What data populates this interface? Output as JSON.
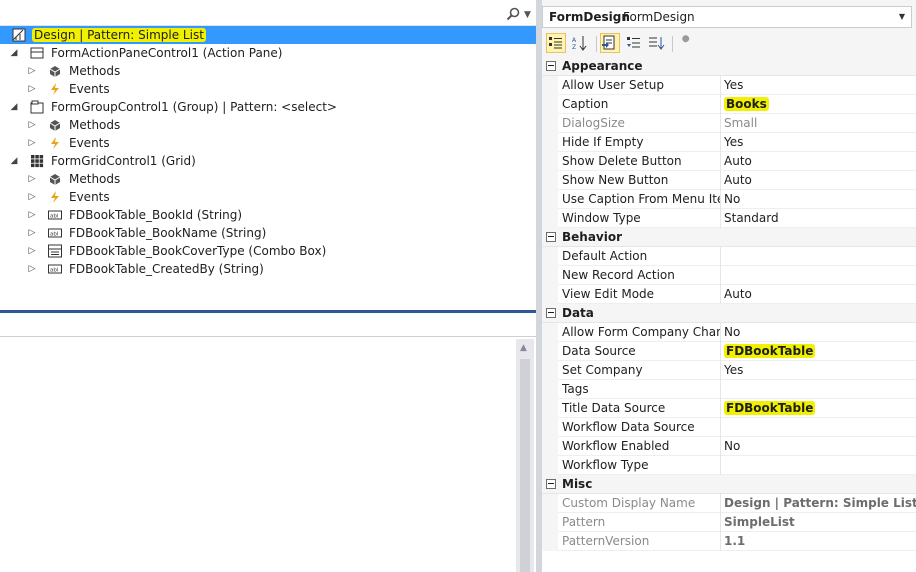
{
  "tree": {
    "root": {
      "label": "Design | Pattern: Simple List"
    },
    "nodes": [
      {
        "label": "FormActionPaneControl1 (Action Pane)"
      },
      {
        "label": "Methods"
      },
      {
        "label": "Events"
      },
      {
        "label": "FormGroupControl1 (Group) | Pattern: <select>"
      },
      {
        "label": "Methods"
      },
      {
        "label": "Events"
      },
      {
        "label": "FormGridControl1 (Grid)"
      },
      {
        "label": "Methods"
      },
      {
        "label": "Events"
      },
      {
        "label": "FDBookTable_BookId (String)"
      },
      {
        "label": "FDBookTable_BookName (String)"
      },
      {
        "label": "FDBookTable_BookCoverType (Combo Box)"
      },
      {
        "label": "FDBookTable_CreatedBy (String)"
      }
    ]
  },
  "properties": {
    "object_name": "FormDesign",
    "object_type": "FormDesign",
    "categories": [
      {
        "title": "Appearance",
        "rows": [
          {
            "name": "Allow User Setup",
            "value": "Yes"
          },
          {
            "name": "Caption",
            "value": "Books"
          },
          {
            "name": "DialogSize",
            "value": "Small"
          },
          {
            "name": "Hide If Empty",
            "value": "Yes"
          },
          {
            "name": "Show Delete Button",
            "value": "Auto"
          },
          {
            "name": "Show New Button",
            "value": "Auto"
          },
          {
            "name": "Use Caption From Menu Item",
            "value": "No"
          },
          {
            "name": "Window Type",
            "value": "Standard"
          }
        ]
      },
      {
        "title": "Behavior",
        "rows": [
          {
            "name": "Default Action",
            "value": ""
          },
          {
            "name": "New Record Action",
            "value": ""
          },
          {
            "name": "View Edit Mode",
            "value": "Auto"
          }
        ]
      },
      {
        "title": "Data",
        "rows": [
          {
            "name": "Allow Form Company Change",
            "value": "No"
          },
          {
            "name": "Data Source",
            "value": "FDBookTable"
          },
          {
            "name": "Set Company",
            "value": "Yes"
          },
          {
            "name": "Tags",
            "value": ""
          },
          {
            "name": "Title Data Source",
            "value": "FDBookTable"
          },
          {
            "name": "Workflow Data Source",
            "value": ""
          },
          {
            "name": "Workflow Enabled",
            "value": "No"
          },
          {
            "name": "Workflow Type",
            "value": ""
          }
        ]
      },
      {
        "title": "Misc",
        "rows": [
          {
            "name": "Custom Display Name",
            "value": "Design | Pattern: Simple List"
          },
          {
            "name": "Pattern",
            "value": "SimpleList"
          },
          {
            "name": "PatternVersion",
            "value": "1.1"
          }
        ]
      }
    ]
  },
  "colors": {
    "selection": "#3399ff",
    "highlight": "#f0f000",
    "event_icon": "#e8a317"
  },
  "icons": {
    "search": "search-icon",
    "design": "design-icon",
    "methods": "methods-icon",
    "events": "lightning-icon",
    "grid": "grid-icon",
    "string": "string-field-icon",
    "combo": "combobox-icon"
  }
}
